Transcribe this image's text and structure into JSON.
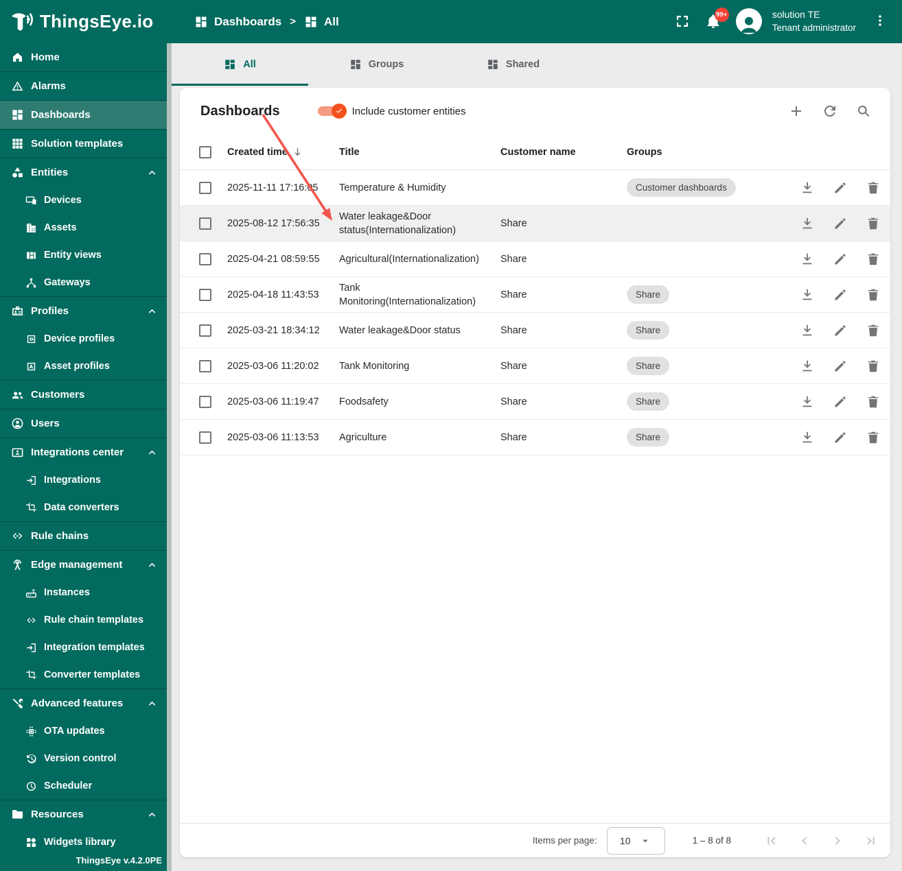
{
  "header": {
    "logo_text": "ThingsEye.io",
    "breadcrumb": {
      "root": "Dashboards",
      "separator": ">",
      "current": "All"
    },
    "notifications_badge": "99+",
    "user": {
      "name": "solution TE",
      "role": "Tenant administrator"
    }
  },
  "sidebar": {
    "version": "ThingsEye v.4.2.0PE",
    "sections": [
      {
        "items": [
          {
            "label": "Home",
            "icon": "home-icon"
          }
        ]
      },
      {
        "items": [
          {
            "label": "Alarms",
            "icon": "alarms-icon"
          }
        ]
      },
      {
        "items": [
          {
            "label": "Dashboards",
            "icon": "dashboards-icon",
            "selected": true
          }
        ]
      },
      {
        "items": [
          {
            "label": "Solution templates",
            "icon": "solution-templates-icon"
          }
        ]
      },
      {
        "items": [
          {
            "label": "Entities",
            "icon": "entities-icon",
            "expandable": true
          },
          {
            "label": "Devices",
            "icon": "devices-icon",
            "sub": true
          },
          {
            "label": "Assets",
            "icon": "assets-icon",
            "sub": true
          },
          {
            "label": "Entity views",
            "icon": "entity-views-icon",
            "sub": true
          },
          {
            "label": "Gateways",
            "icon": "gateways-icon",
            "sub": true
          }
        ]
      },
      {
        "items": [
          {
            "label": "Profiles",
            "icon": "profiles-icon",
            "expandable": true
          },
          {
            "label": "Device profiles",
            "icon": "device-profiles-icon",
            "sub": true
          },
          {
            "label": "Asset profiles",
            "icon": "asset-profiles-icon",
            "sub": true
          }
        ]
      },
      {
        "items": [
          {
            "label": "Customers",
            "icon": "customers-icon"
          }
        ]
      },
      {
        "items": [
          {
            "label": "Users",
            "icon": "users-icon"
          }
        ]
      },
      {
        "items": [
          {
            "label": "Integrations center",
            "icon": "integrations-center-icon",
            "expandable": true
          },
          {
            "label": "Integrations",
            "icon": "integrations-icon",
            "sub": true
          },
          {
            "label": "Data converters",
            "icon": "data-converters-icon",
            "sub": true
          }
        ]
      },
      {
        "items": [
          {
            "label": "Rule chains",
            "icon": "rule-chains-icon"
          }
        ]
      },
      {
        "items": [
          {
            "label": "Edge management",
            "icon": "edge-management-icon",
            "expandable": true
          },
          {
            "label": "Instances",
            "icon": "instances-icon",
            "sub": true
          },
          {
            "label": "Rule chain templates",
            "icon": "rule-chain-templates-icon",
            "sub": true
          },
          {
            "label": "Integration templates",
            "icon": "integration-templates-icon",
            "sub": true
          },
          {
            "label": "Converter templates",
            "icon": "converter-templates-icon",
            "sub": true
          }
        ]
      },
      {
        "items": [
          {
            "label": "Advanced features",
            "icon": "advanced-features-icon",
            "expandable": true
          },
          {
            "label": "OTA updates",
            "icon": "ota-updates-icon",
            "sub": true
          },
          {
            "label": "Version control",
            "icon": "version-control-icon",
            "sub": true
          },
          {
            "label": "Scheduler",
            "icon": "scheduler-icon",
            "sub": true
          }
        ]
      },
      {
        "items": [
          {
            "label": "Resources",
            "icon": "resources-icon",
            "expandable": true
          },
          {
            "label": "Widgets library",
            "icon": "widgets-library-icon",
            "sub": true
          }
        ]
      }
    ]
  },
  "tabs": [
    {
      "label": "All",
      "icon": "dashboards-icon",
      "active": true
    },
    {
      "label": "Groups",
      "icon": "dashboards-icon",
      "active": false
    },
    {
      "label": "Shared",
      "icon": "dashboards-icon",
      "active": false
    }
  ],
  "panel": {
    "title": "Dashboards",
    "toggle_label": "Include customer entities",
    "toggle_on": true,
    "toolbar_icons": [
      "add-icon",
      "refresh-icon",
      "search-icon"
    ]
  },
  "table": {
    "columns": [
      "Created time",
      "Title",
      "Customer name",
      "Groups"
    ],
    "sorted_column": "Created time",
    "sort_direction": "desc",
    "row_actions": [
      "download-icon",
      "edit-icon",
      "delete-icon"
    ],
    "rows": [
      {
        "created": "2025-11-11 17:16:05",
        "title": "Temperature & Humidity",
        "customer": "",
        "groups": [
          "Customer dashboards"
        ],
        "highlighted": false
      },
      {
        "created": "2025-08-12 17:56:35",
        "title": "Water leakage&Door status(Internationalization)",
        "customer": "Share",
        "groups": [],
        "highlighted": true
      },
      {
        "created": "2025-04-21 08:59:55",
        "title": "Agricultural(Internationalization)",
        "customer": "Share",
        "groups": [],
        "highlighted": false
      },
      {
        "created": "2025-04-18 11:43:53",
        "title": "Tank Monitoring(Internationalization)",
        "customer": "Share",
        "groups": [
          "Share"
        ],
        "highlighted": false
      },
      {
        "created": "2025-03-21 18:34:12",
        "title": "Water leakage&Door status",
        "customer": "Share",
        "groups": [
          "Share"
        ],
        "highlighted": false
      },
      {
        "created": "2025-03-06 11:20:02",
        "title": "Tank Monitoring",
        "customer": "Share",
        "groups": [
          "Share"
        ],
        "highlighted": false
      },
      {
        "created": "2025-03-06 11:19:47",
        "title": "Foodsafety",
        "customer": "Share",
        "groups": [
          "Share"
        ],
        "highlighted": false
      },
      {
        "created": "2025-03-06 11:13:53",
        "title": "Agriculture",
        "customer": "Share",
        "groups": [
          "Share"
        ],
        "highlighted": false
      }
    ]
  },
  "pagination": {
    "items_per_page_label": "Items per page:",
    "items_per_page": "10",
    "range": "1 – 8 of 8",
    "nav_icons": [
      "first-page-icon",
      "prev-page-icon",
      "next-page-icon",
      "last-page-icon"
    ]
  },
  "colors": {
    "header_teal": "#026A5E",
    "selected_item_teal": "#2F7D72",
    "active_tab_teal": "#01695E",
    "toggle_thumb": "#F4511E",
    "toggle_track": "#F59B80",
    "badge_red": "#F44336",
    "annotation_arrow_red": "#F2564D",
    "chip_gray": "#E1E1E1"
  }
}
